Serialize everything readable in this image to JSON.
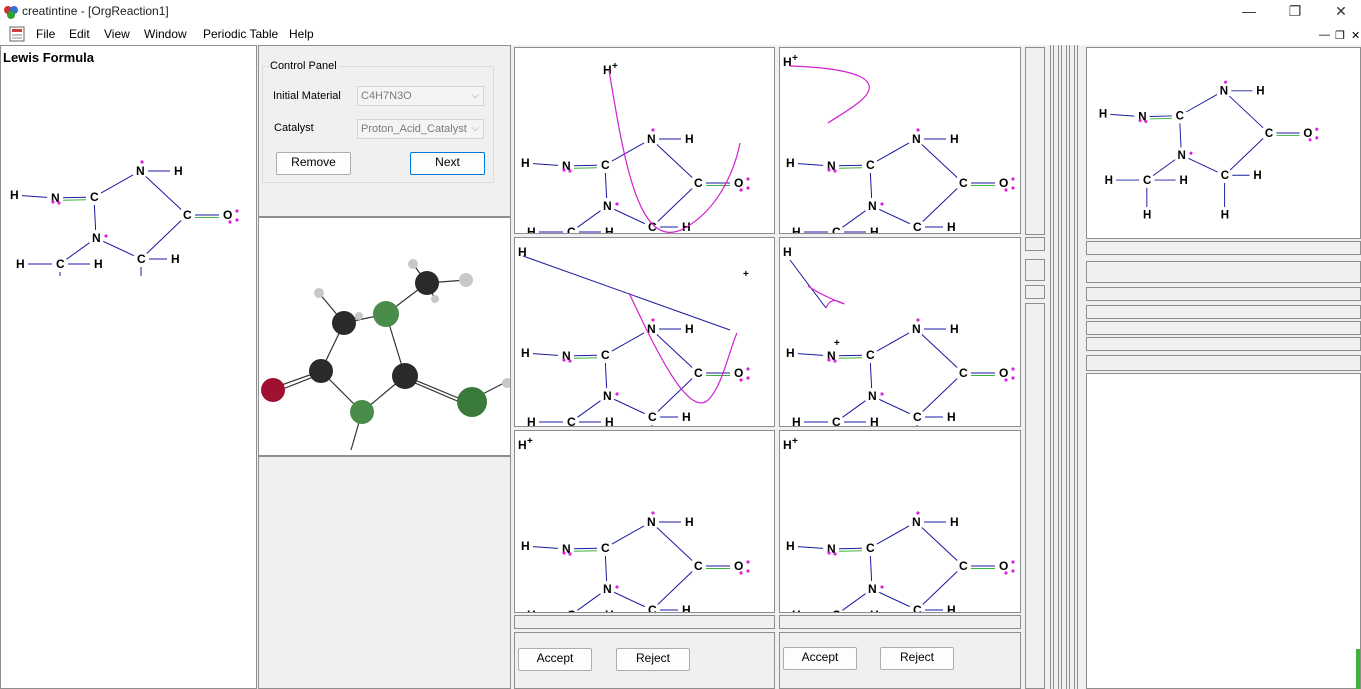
{
  "window": {
    "title": "creatintine - [OrgReaction1]",
    "minimize": "—",
    "restore": "❐",
    "close": "✕"
  },
  "menu": {
    "items": [
      "File",
      "Edit",
      "View",
      "Window",
      "Periodic Table",
      "Help"
    ]
  },
  "left_panel": {
    "title": "Lewis Formula"
  },
  "control_panel": {
    "group_title": "Control Panel",
    "initial_material_label": "Initial Material",
    "initial_material_value": "C4H7N3O",
    "catalyst_label": "Catalyst",
    "catalyst_value": "Proton_Acid_Catalyst",
    "remove_label": "Remove",
    "next_label": "Next"
  },
  "accept_reject": {
    "accept_label": "Accept",
    "reject_label": "Reject"
  },
  "atoms": {
    "H": "H",
    "C": "C",
    "N": "N",
    "O": "O",
    "plus": "+"
  },
  "colors": {
    "bond": "#1a1aa0",
    "double_bond": "#3cb43c",
    "lone_pair": "#e020e0",
    "arrow": "#d020d0"
  }
}
